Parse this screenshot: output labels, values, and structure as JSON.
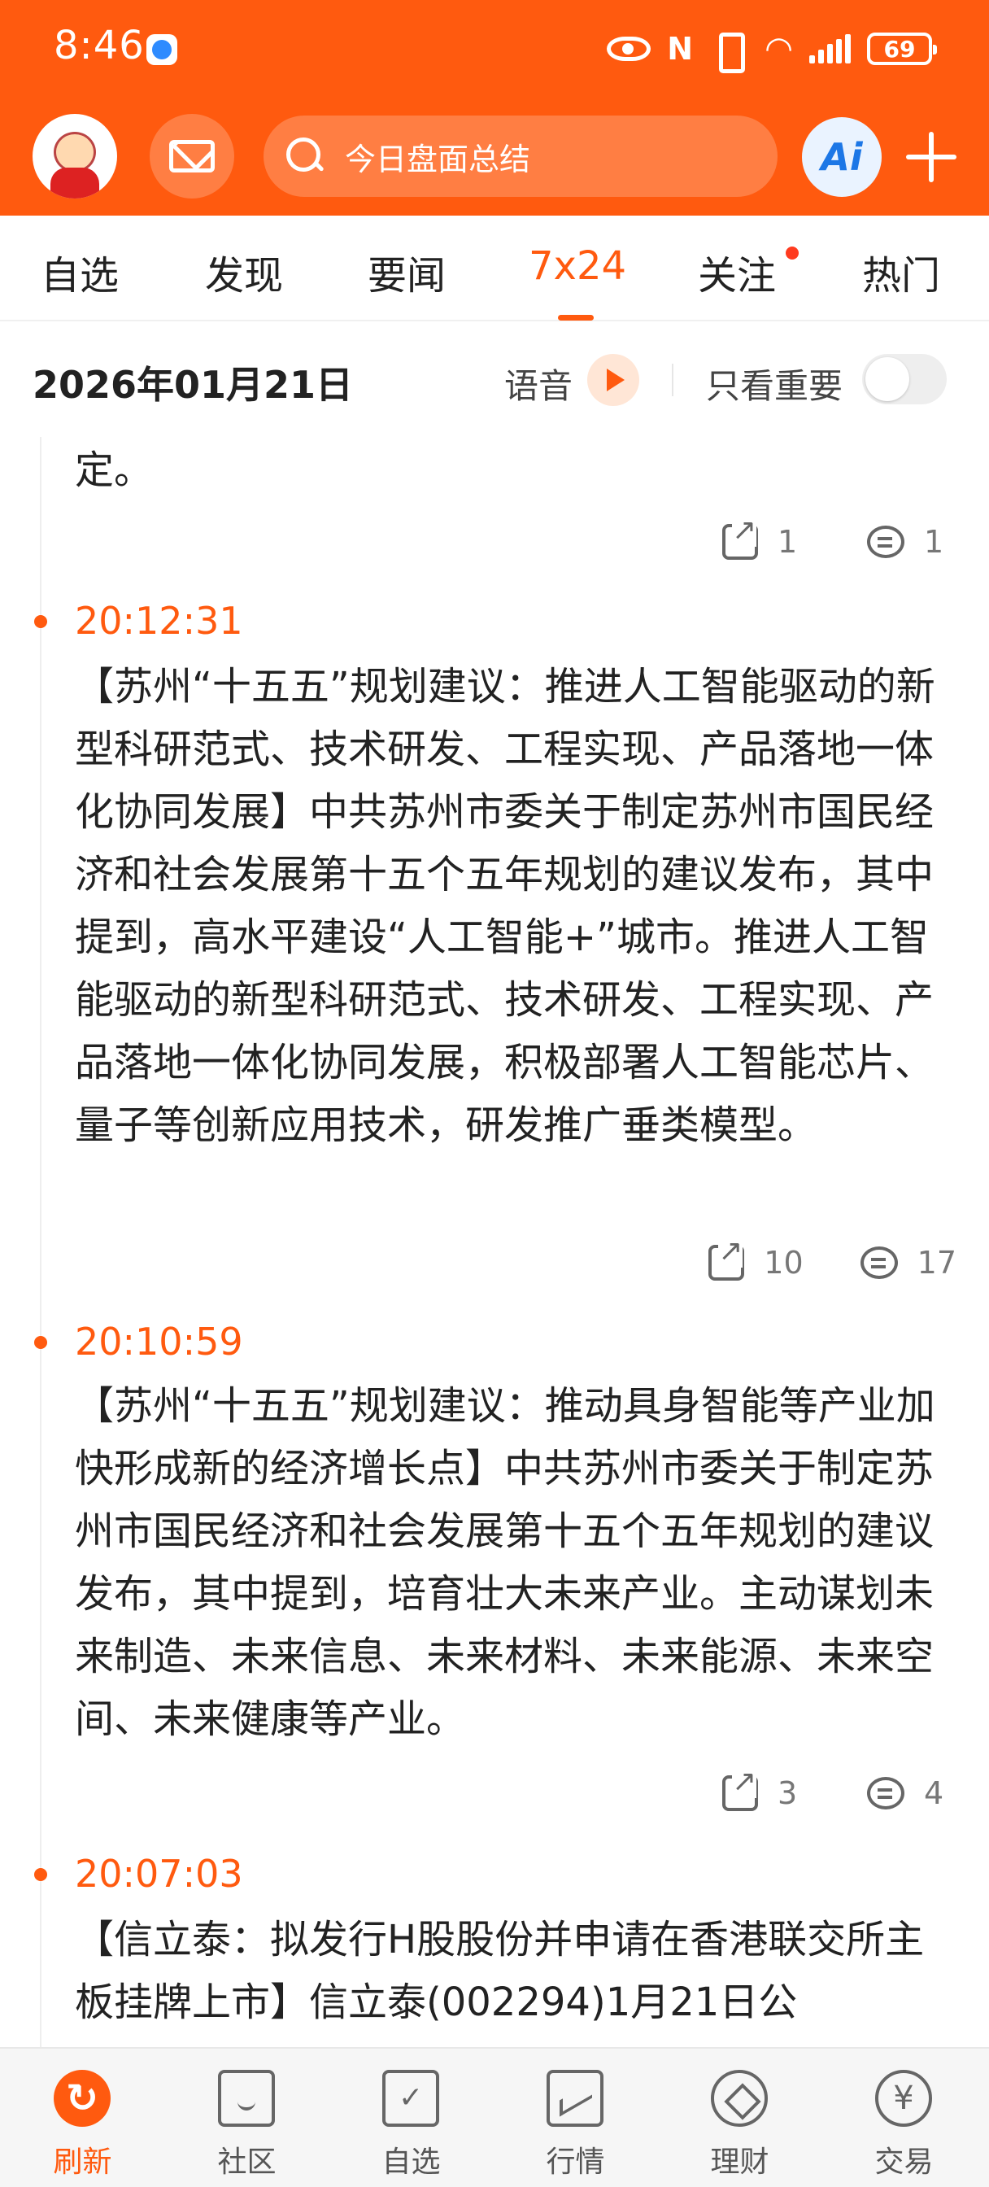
{
  "status_bar": {
    "time": "8:46",
    "battery": "69"
  },
  "header": {
    "search_placeholder": "今日盘面总结",
    "ai_label": "Ai"
  },
  "tabs": [
    {
      "label": "自选"
    },
    {
      "label": "发现"
    },
    {
      "label": "要闻"
    },
    {
      "label": "7x24"
    },
    {
      "label": "关注"
    },
    {
      "label": "热门"
    }
  ],
  "date_bar": {
    "date": "2026年01月21日",
    "voice_label": "语音",
    "important_label": "只看重要"
  },
  "feed": {
    "partial": {
      "text": "定。",
      "shares": "1",
      "comments": "1"
    },
    "items": [
      {
        "time": "20:12:31",
        "text": "【苏州“十五五”规划建议：推进人工智能驱动的新型科研范式、技术研发、工程实现、产品落地一体化协同发展】中共苏州市委关于制定苏州市国民经济和社会发展第十五个五年规划的建议发布，其中提到，高水平建设“人工智能+”城市。推进人工智能驱动的新型科研范式、技术研发、工程实现、产品落地一体化协同发展，积极部署人工智能芯片、量子等创新应用技术，研发推广垂类模型。",
        "shares": "10",
        "comments": "17"
      },
      {
        "time": "20:10:59",
        "text": "【苏州“十五五”规划建议：推动具身智能等产业加快形成新的经济增长点】中共苏州市委关于制定苏州市国民经济和社会发展第十五个五年规划的建议发布，其中提到，培育壮大未来产业。主动谋划未来制造、未来信息、未来材料、未来能源、未来空间、未来健康等产业。",
        "shares": "3",
        "comments": "4"
      },
      {
        "time": "20:07:03",
        "text": "【信立泰：拟发行H股股份并申请在香港联交所主板挂牌上市】信立泰(002294)1月21日公"
      }
    ]
  },
  "bottom_nav": [
    {
      "label": "刷新"
    },
    {
      "label": "社区"
    },
    {
      "label": "自选"
    },
    {
      "label": "行情"
    },
    {
      "label": "理财"
    },
    {
      "label": "交易"
    }
  ],
  "colors": {
    "accent": "#ff5a0f",
    "text": "#222222",
    "muted": "#777777"
  }
}
